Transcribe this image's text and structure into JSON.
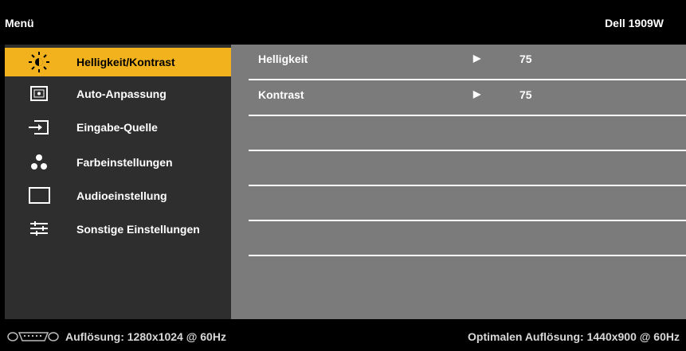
{
  "header": {
    "menu_title": "Menü",
    "model": "Dell 1909W"
  },
  "sidebar": {
    "items": [
      {
        "label": "Helligkeit/Kontrast",
        "icon": "brightness-icon",
        "active": true
      },
      {
        "label": "Auto-Anpassung",
        "icon": "auto-adjust-icon",
        "active": false
      },
      {
        "label": "Eingabe-Quelle",
        "icon": "input-source-icon",
        "active": false
      },
      {
        "label": "Farbeinstellungen",
        "icon": "color-settings-icon",
        "active": false
      },
      {
        "label": "Audioeinstellung",
        "icon": "audio-settings-icon",
        "active": false
      },
      {
        "label": "Sonstige Einstellungen",
        "icon": "other-settings-icon",
        "active": false
      }
    ]
  },
  "main": {
    "rows": [
      {
        "label": "Helligkeit",
        "value": "75",
        "arrow": "▶"
      },
      {
        "label": "Kontrast",
        "value": "75",
        "arrow": "▶"
      },
      {
        "label": "",
        "value": "",
        "arrow": ""
      },
      {
        "label": "",
        "value": "",
        "arrow": ""
      },
      {
        "label": "",
        "value": "",
        "arrow": ""
      },
      {
        "label": "",
        "value": "",
        "arrow": ""
      }
    ]
  },
  "footer": {
    "resolution": "Auflösung: 1280x1024 @ 60Hz",
    "optimal": "Optimalen Auflösung: 1440x900 @ 60Hz",
    "vga_icon": "vga-connector-icon"
  },
  "colors": {
    "accent": "#f2b21e",
    "sidebar": "#2e2e2e",
    "panel": "#7b7b7b"
  }
}
